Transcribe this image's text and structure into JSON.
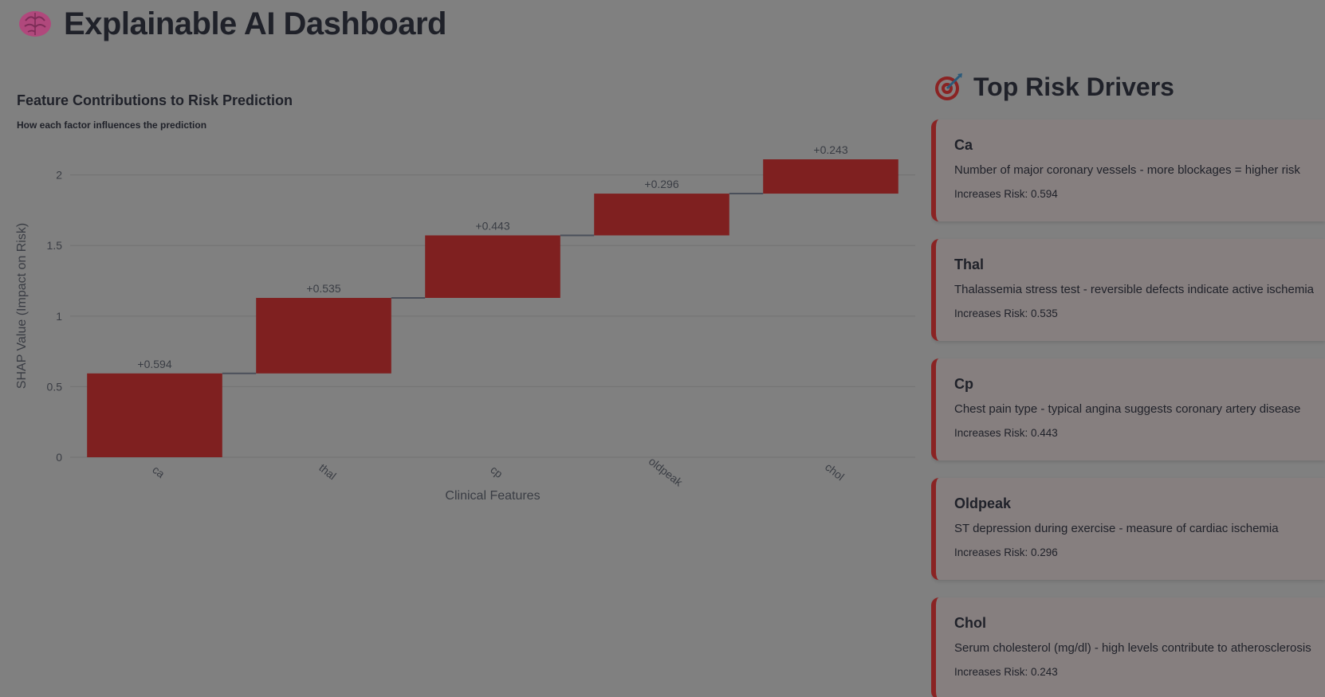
{
  "header": {
    "title": "Explainable AI Dashboard",
    "icon": "brain-icon"
  },
  "chart_data": {
    "type": "waterfall",
    "title": "Feature Contributions to Risk Prediction",
    "subtitle": "How each factor influences the prediction",
    "xlabel": "Clinical Features",
    "ylabel": "SHAP Value (Impact on Risk)",
    "categories": [
      "ca",
      "thal",
      "cp",
      "oldpeak",
      "chol"
    ],
    "values": [
      0.594,
      0.535,
      0.443,
      0.296,
      0.243
    ],
    "data_labels": [
      "+0.594",
      "+0.535",
      "+0.443",
      "+0.296",
      "+0.243"
    ],
    "y_ticks": [
      0,
      0.5,
      1,
      1.5,
      2
    ],
    "y_tick_labels": [
      "0",
      "0.5",
      "1",
      "1.5",
      "2"
    ],
    "ylim": [
      0,
      2.111
    ],
    "grid": true,
    "bar_color": "#7f2020",
    "connector_color": "#4a4f5a"
  },
  "side_panel": {
    "title": "Top Risk Drivers",
    "icon": "target-icon",
    "accent_color": "#8a2323",
    "drivers": [
      {
        "name": "Ca",
        "description": "Number of major coronary vessels - more blockages = higher risk",
        "impact": "Increases Risk: 0.594"
      },
      {
        "name": "Thal",
        "description": "Thalassemia stress test - reversible defects indicate active ischemia",
        "impact": "Increases Risk: 0.535"
      },
      {
        "name": "Cp",
        "description": "Chest pain type - typical angina suggests coronary artery disease",
        "impact": "Increases Risk: 0.443"
      },
      {
        "name": "Oldpeak",
        "description": "ST depression during exercise - measure of cardiac ischemia",
        "impact": "Increases Risk: 0.296"
      },
      {
        "name": "Chol",
        "description": "Serum cholesterol (mg/dl) - high levels contribute to atherosclerosis",
        "impact": "Increases Risk: 0.243"
      }
    ]
  }
}
